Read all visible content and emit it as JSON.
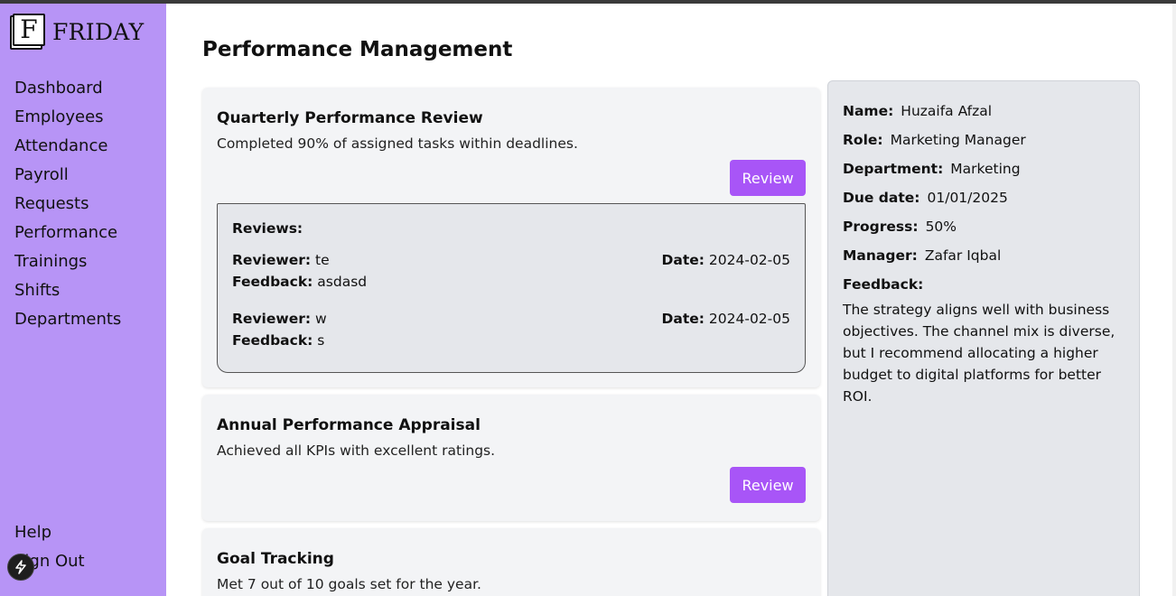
{
  "app": {
    "name": "FRIDAY",
    "logo_letter": "F"
  },
  "sidebar": {
    "items": [
      {
        "label": "Dashboard"
      },
      {
        "label": "Employees"
      },
      {
        "label": "Attendance"
      },
      {
        "label": "Payroll"
      },
      {
        "label": "Requests"
      },
      {
        "label": "Performance"
      },
      {
        "label": "Trainings"
      },
      {
        "label": "Shifts"
      },
      {
        "label": "Departments"
      }
    ],
    "bottom_items": [
      {
        "label": "Help"
      },
      {
        "label": "Sign Out"
      }
    ]
  },
  "page": {
    "title": "Performance Management"
  },
  "cards": [
    {
      "title": "Quarterly Performance Review",
      "description": "Completed 90% of assigned tasks within deadlines.",
      "button_label": "Review",
      "reviews_heading": "Reviews:",
      "reviews": [
        {
          "reviewer_label": "Reviewer:",
          "reviewer": "te",
          "date_label": "Date:",
          "date": "2024-02-05",
          "feedback_label": "Feedback:",
          "feedback": "asdasd"
        },
        {
          "reviewer_label": "Reviewer:",
          "reviewer": "w",
          "date_label": "Date:",
          "date": "2024-02-05",
          "feedback_label": "Feedback:",
          "feedback": "s"
        }
      ]
    },
    {
      "title": "Annual Performance Appraisal",
      "description": "Achieved all KPIs with excellent ratings.",
      "button_label": "Review"
    },
    {
      "title": "Goal Tracking",
      "description": "Met 7 out of 10 goals set for the year."
    }
  ],
  "details": {
    "name_label": "Name:",
    "name": "Huzaifa Afzal",
    "role_label": "Role:",
    "role": "Marketing Manager",
    "department_label": "Department:",
    "department": "Marketing",
    "due_label": "Due date:",
    "due": "01/01/2025",
    "progress_label": "Progress:",
    "progress": "50%",
    "manager_label": "Manager:",
    "manager": "Zafar Iqbal",
    "feedback_label": "Feedback:",
    "feedback": "The strategy aligns well with business objectives. The channel mix is diverse, but I recommend allocating a higher budget to digital platforms for better ROI."
  },
  "colors": {
    "sidebar": "#b794f6",
    "accent": "#a855f7",
    "card": "#f3f4f6",
    "panel": "#e5e7eb"
  },
  "icons": {
    "dev_tools": "lightning-bolt-icon"
  }
}
